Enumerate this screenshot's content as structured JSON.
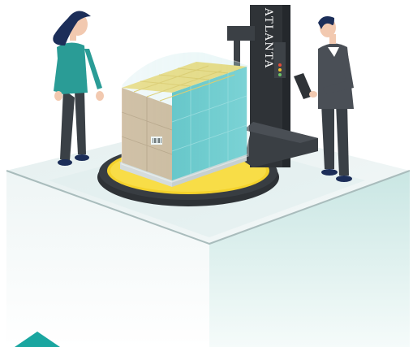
{
  "machine": {
    "brand": "ATLANTA"
  },
  "colors": {
    "turntable": "#f4d22b",
    "machine_body": "#2f3337",
    "pallet_wrap": "#6fd0d3",
    "platform_top": "#eaf3f3",
    "platform_side_left": "#f3f7f7",
    "platform_side_right": "#d7ecea",
    "accent_triangle": "#1aa6a0",
    "woman_shirt": "#2a9c96",
    "woman_hair": "#1c2e59",
    "man_jacket": "#4a4f56",
    "trousers": "#3a4046"
  },
  "icons": [
    "barcode-icon",
    "indicator-lights-icon"
  ]
}
